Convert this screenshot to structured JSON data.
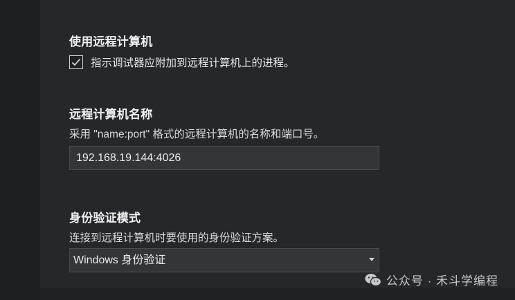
{
  "remote_machine_toggle": {
    "heading": "使用远程计算机",
    "checkbox_label": "指示调试器应附加到远程计算机上的进程。",
    "checked": true
  },
  "remote_machine_name": {
    "heading": "远程计算机名称",
    "description": "采用 \"name:port\" 格式的远程计算机的名称和端口号。",
    "value": "192.168.19.144:4026"
  },
  "auth_mode": {
    "heading": "身份验证模式",
    "description": "连接到远程计算机时要使用的身份验证方案。",
    "selected": "Windows 身份验证"
  },
  "watermark": {
    "text": "公众号 · 禾斗学编程",
    "icon": "wechat-icon"
  },
  "colors": {
    "background": "#1f2124",
    "panel": "#25272b",
    "input_background": "#333539",
    "input_border": "#4a4c50",
    "text": "#e6e6e6"
  }
}
